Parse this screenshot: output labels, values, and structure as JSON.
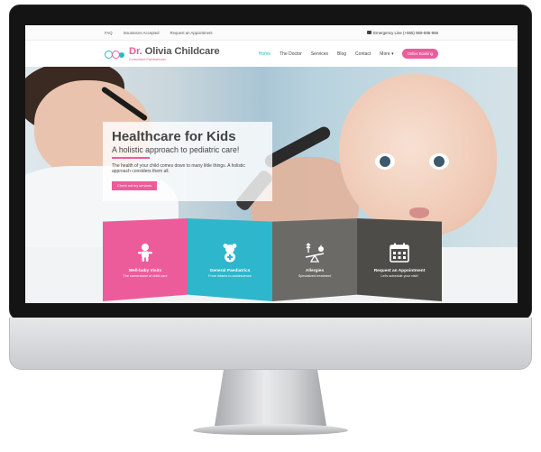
{
  "topbar": {
    "links": [
      "FAQ",
      "Insurances Accepted",
      "Request an Appointment"
    ],
    "emergency": "Emergency Line (+555) 959-595-959"
  },
  "header": {
    "logo_prefix": "Dr.",
    "logo_name": "Olivia Childcare",
    "logo_sub": "Consultant Paediatrician",
    "nav": [
      "Home",
      "The Doctor",
      "Services",
      "Blog",
      "Contact",
      "More"
    ],
    "nav_active": "Home",
    "booking_label": "Online Booking"
  },
  "hero": {
    "title": "Healthcare for Kids",
    "subtitle": "A holistic approach to pediatric care!",
    "text": "The health of your child comes down to many little things. A holistic approach considers them all.",
    "button": "Check out my services"
  },
  "tiles": [
    {
      "title": "Well-baby Visits",
      "subtitle": "The cornerstone of child care",
      "icon": "baby-icon"
    },
    {
      "title": "General Paediatrics",
      "subtitle": "From infants to adolescence",
      "icon": "teddy-bear-icon"
    },
    {
      "title": "Allergies",
      "subtitle": "Specialized treatment",
      "icon": "balance-scale-icon"
    },
    {
      "title": "Request an Appointment",
      "subtitle": "Let's schedule your visit!",
      "icon": "calendar-icon"
    }
  ],
  "colors": {
    "pink": "#ec5c9b",
    "teal": "#2eb6cc",
    "grey": "#6b6a66",
    "dark": "#4e4c48"
  }
}
